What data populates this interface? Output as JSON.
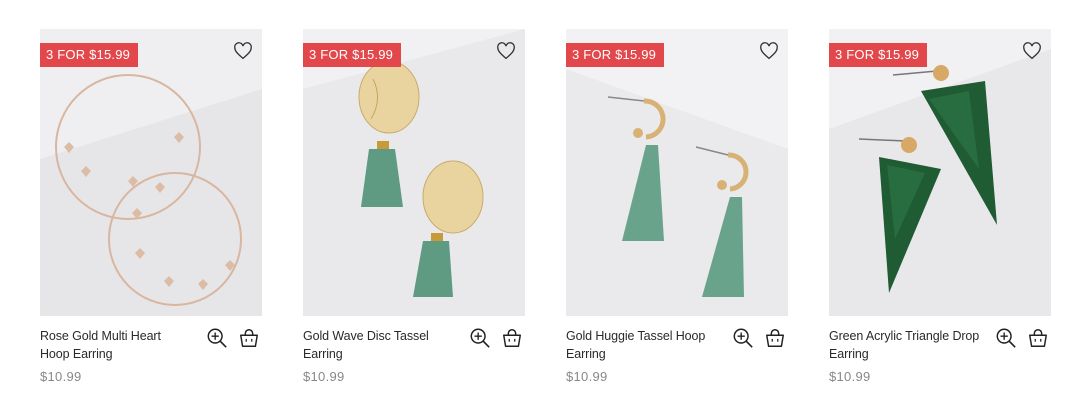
{
  "products": [
    {
      "promo": "3 FOR $15.99",
      "name": "Rose Gold Multi Heart Hoop Earring",
      "price": "$10.99"
    },
    {
      "promo": "3 FOR $15.99",
      "name": "Gold Wave Disc Tassel Earring",
      "price": "$10.99"
    },
    {
      "promo": "3 FOR $15.99",
      "name": "Gold Huggie Tassel Hoop Earring",
      "price": "$10.99"
    },
    {
      "promo": "3 FOR $15.99",
      "name": "Green Acrylic Triangle Drop Earring",
      "price": "$10.99"
    }
  ],
  "icons": {
    "wishlist": "heart-outline-icon",
    "quick_view": "zoom-in-icon",
    "add_to_bag": "shopping-bag-icon"
  },
  "colors": {
    "promo_badge": "#e2474b",
    "price_text": "#888888",
    "tassel_green": "#5f9b82",
    "acrylic_green": "#1f5b33"
  }
}
